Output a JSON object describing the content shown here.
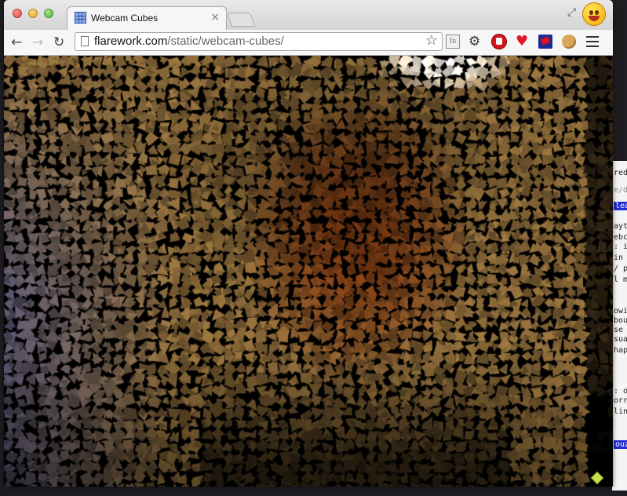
{
  "window": {
    "tab_title": "Webcam Cubes",
    "tab_close": "×",
    "url_host": "flarework.com",
    "url_path": "/static/webcam-cubes/"
  },
  "toolbar": {
    "back": "←",
    "forward": "→",
    "reload": "↻",
    "bookmark_star": "☆",
    "extensions": [
      "instapaper-icon",
      "settings-gear-icon",
      "adblock-icon",
      "heart-icon",
      "flag-icon",
      "cookie-icon",
      "menu-icon"
    ],
    "instapaper_label": "In",
    "settings_glyph": "⚙",
    "heart_glyph": "♥"
  },
  "side_window": {
    "lines": [
      {
        "text": "red",
        "style": "plain"
      },
      {
        "text": "e/d",
        "style": "dim"
      },
      {
        "text": "leas",
        "style": "hl"
      },
      {
        "text": "ayth",
        "style": "plain"
      },
      {
        "text": "ebco",
        "style": "plain"
      },
      {
        "text": ": ir",
        "style": "plain"
      },
      {
        "text": "in",
        "style": "plain"
      },
      {
        "text": "/ pe",
        "style": "plain"
      },
      {
        "text": "l me",
        "style": "plain"
      },
      {
        "text": "owir",
        "style": "plain"
      },
      {
        "text": "bout",
        "style": "plain"
      },
      {
        "text": "se y",
        "style": "plain"
      },
      {
        "text": "sual",
        "style": "plain"
      },
      {
        "text": "happ",
        "style": "plain"
      },
      {
        "text": ": or",
        "style": "plain"
      },
      {
        "text": "orry",
        "style": "plain"
      },
      {
        "text": "ling",
        "style": "plain"
      },
      {
        "text": "ouzz",
        "style": "hl"
      }
    ]
  },
  "colors": {
    "wall_warm": "#b08a48",
    "wall_cool": "#6f6a86",
    "face": "#9a4a12",
    "highlight": "#ffffff"
  }
}
